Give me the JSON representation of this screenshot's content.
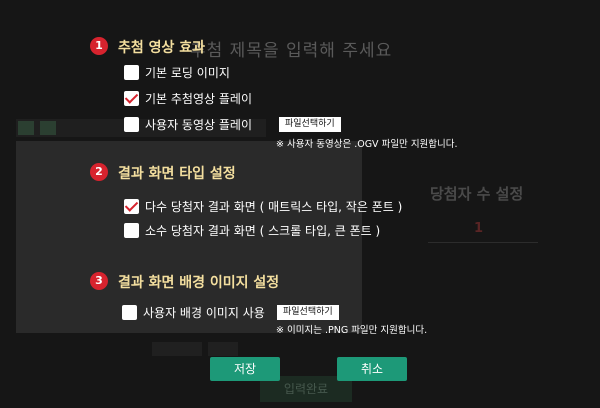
{
  "background": {
    "title_placeholder": "추첨 제목을 입력해 주세요",
    "count_title": "당첨자 수 설정",
    "count_value": "1",
    "bottom_button": "입력완료"
  },
  "sections": [
    {
      "number": "1",
      "title": "추첨 영상 효과",
      "options": [
        {
          "label": "기본 로딩 이미지",
          "checked": false
        },
        {
          "label": "기본 추첨영상 플레이",
          "checked": true
        },
        {
          "label": "사용자 동영상 플레이",
          "checked": false
        }
      ],
      "file_button": "파일선택하기",
      "note": "※ 사용자 동영상은 .OGV 파일만 지원합니다."
    },
    {
      "number": "2",
      "title": "결과 화면 타입 설정",
      "options": [
        {
          "label": "다수 당첨자 결과 화면 ( 매트릭스 타입, 작은 폰트 )",
          "checked": true
        },
        {
          "label": "소수 당첨자 결과 화면 ( 스크롤 타입, 큰 폰트 )",
          "checked": false
        }
      ]
    },
    {
      "number": "3",
      "title": "결과 화면 배경 이미지 설정",
      "options": [
        {
          "label": "사용자 배경 이미지 사용",
          "checked": false
        }
      ],
      "file_button": "파일선택하기",
      "note": "※ 이미지는 .PNG 파일만 지원합니다."
    }
  ],
  "actions": {
    "save": "저장",
    "cancel": "취소"
  },
  "colors": {
    "accent_title": "#f4df9f",
    "badge": "#d7232e",
    "button": "#1d9978"
  }
}
